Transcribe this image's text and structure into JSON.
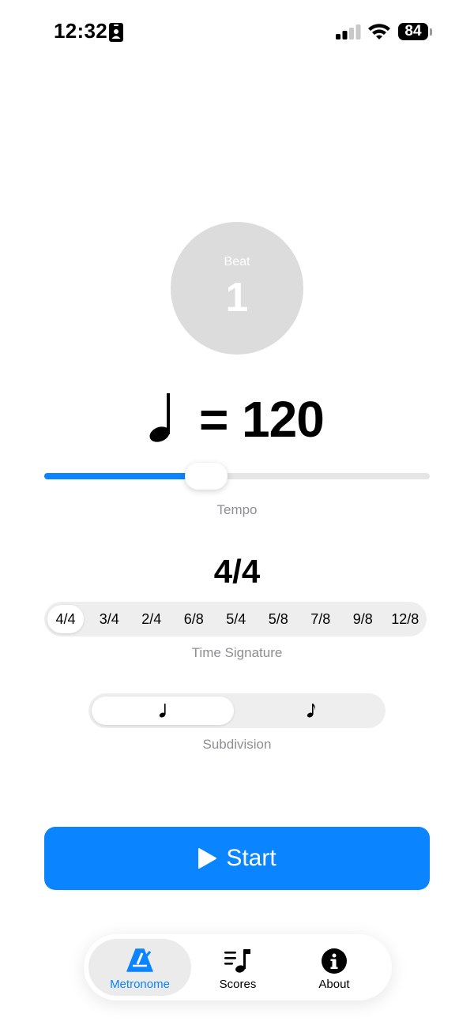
{
  "status_bar": {
    "time": "12:32",
    "battery": "84",
    "icons": [
      "id-card-icon",
      "cellular-signal-icon",
      "wifi-icon",
      "battery-icon"
    ]
  },
  "beat": {
    "label": "Beat",
    "value": "1"
  },
  "tempo": {
    "note_icon": "quarter-note-icon",
    "equals": "=",
    "bpm": "120",
    "label": "Tempo",
    "slider_fraction": 0.42
  },
  "time_signature": {
    "current": "4/4",
    "options": [
      "4/4",
      "3/4",
      "2/4",
      "6/8",
      "5/4",
      "5/8",
      "7/8",
      "9/8",
      "12/8"
    ],
    "selected": "4/4",
    "label": "Time Signature"
  },
  "subdivision": {
    "options": [
      "quarter-note-icon",
      "eighth-note-icon"
    ],
    "selected": "quarter-note-icon",
    "label": "Subdivision"
  },
  "start_button": {
    "label": "Start",
    "icon": "play-icon"
  },
  "tab_bar": {
    "tabs": [
      {
        "label": "Metronome",
        "icon": "metronome-icon",
        "active": true
      },
      {
        "label": "Scores",
        "icon": "scores-icon",
        "active": false
      },
      {
        "label": "About",
        "icon": "info-icon",
        "active": false
      }
    ]
  },
  "colors": {
    "accent": "#0a84ff",
    "beat_circle": "#dcdcdc",
    "caption": "#8e8e93"
  }
}
